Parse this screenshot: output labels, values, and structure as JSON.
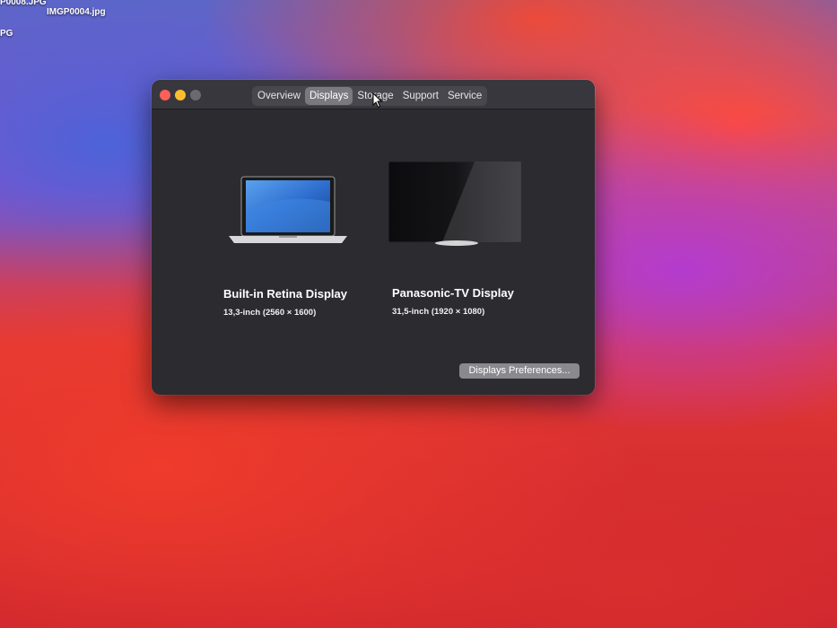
{
  "desktop": {
    "files": [
      "P0008.JPG",
      "IMGP0004.jpg",
      "PG"
    ]
  },
  "window": {
    "tabs": [
      {
        "label": "Overview",
        "active": false
      },
      {
        "label": "Displays",
        "active": true
      },
      {
        "label": "Storage",
        "active": false
      },
      {
        "label": "Support",
        "active": false
      },
      {
        "label": "Service",
        "active": false
      }
    ],
    "displays": [
      {
        "name": "Built-in Retina Display",
        "size": "13,3-inch (2560 × 1600)"
      },
      {
        "name": "Panasonic-TV Display",
        "size": "31,5-inch (1920 × 1080)"
      }
    ],
    "preferences_button": "Displays Preferences..."
  },
  "colors": {
    "close": "#ff5f57",
    "minimize": "#febc2e",
    "window_bg": "#2c2b30",
    "active_tab": "#7a797f"
  }
}
